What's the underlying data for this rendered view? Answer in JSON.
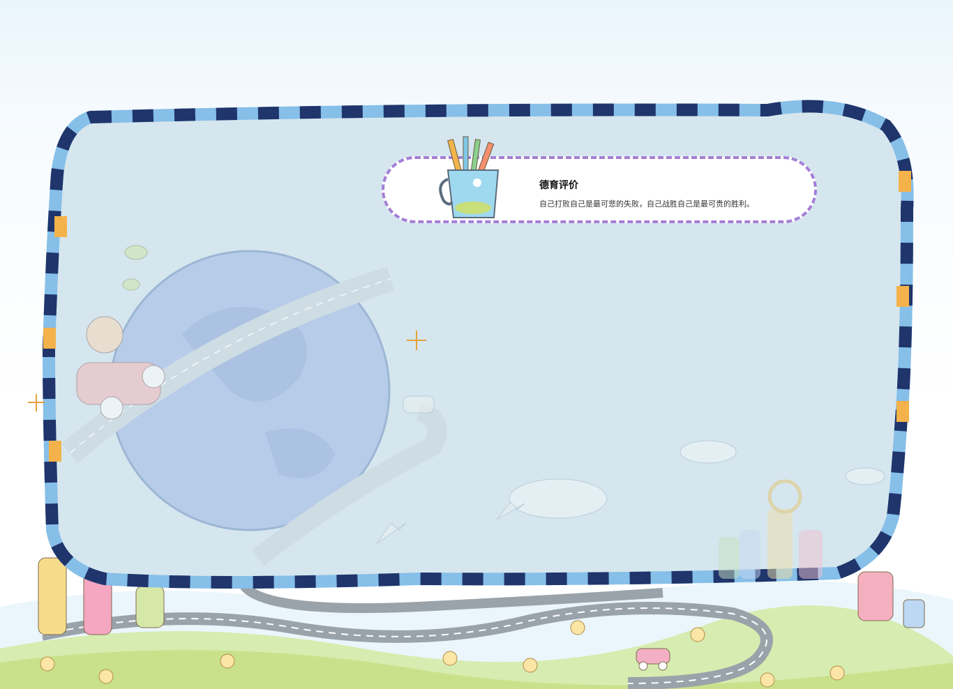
{
  "card": {
    "title": "德育评价",
    "subtitle": "自己打败自己是最可悲的失败，自己战胜自己是最可贵的胜利。"
  },
  "colors": {
    "frame_dark": "#1f356b",
    "frame_light": "#86bfe8",
    "frame_orange": "#f4b24a",
    "panel": "#d5e6ee",
    "card_border": "#a47fd6",
    "grass": "#c9e18a"
  }
}
